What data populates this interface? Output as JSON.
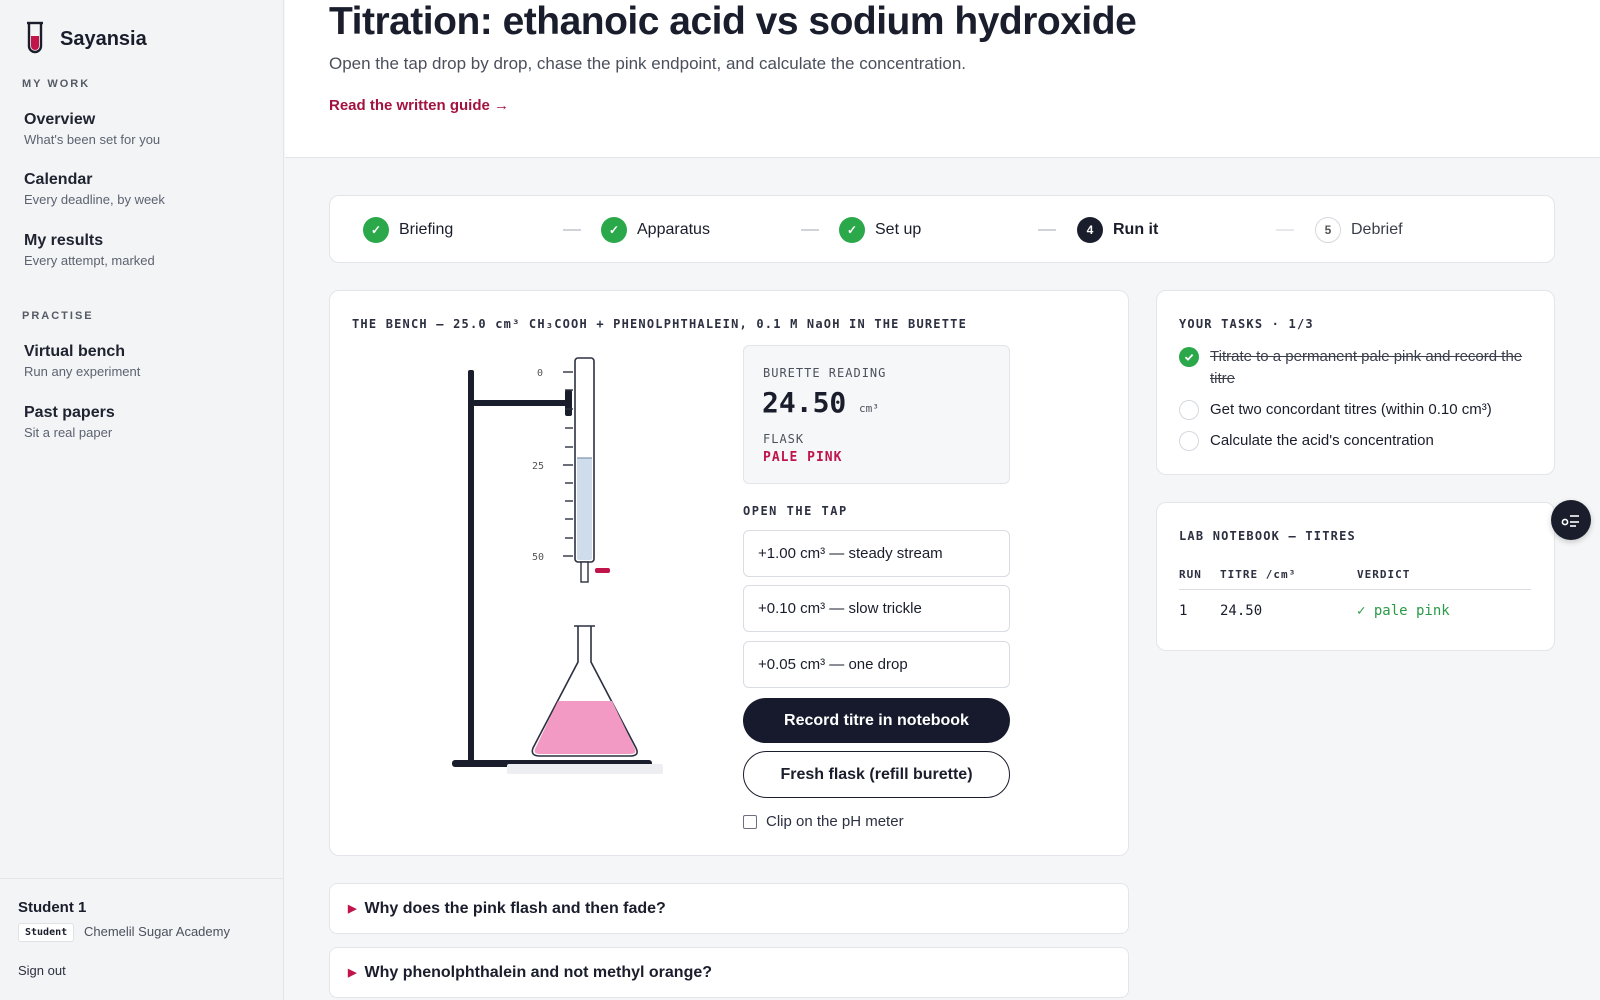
{
  "app": {
    "name": "Sayansia"
  },
  "sidebar": {
    "sections": [
      {
        "label": "MY WORK",
        "items": [
          {
            "title": "Overview",
            "subtitle": "What's been set for you"
          },
          {
            "title": "Calendar",
            "subtitle": "Every deadline, by week"
          },
          {
            "title": "My results",
            "subtitle": "Every attempt, marked"
          }
        ]
      },
      {
        "label": "PRACTISE",
        "items": [
          {
            "title": "Virtual bench",
            "subtitle": "Run any experiment"
          },
          {
            "title": "Past papers",
            "subtitle": "Sit a real paper"
          }
        ]
      }
    ],
    "user": {
      "name": "Student 1",
      "role": "Student",
      "school": "Chemelil Sugar Academy",
      "sign_out": "Sign out"
    }
  },
  "header": {
    "title": "Titration: ethanoic acid vs sodium hydroxide",
    "subtitle": "Open the tap drop by drop, chase the pink endpoint, and calculate the concentration.",
    "guide_link": "Read the written guide →"
  },
  "stepper": {
    "steps": [
      {
        "label": "Briefing",
        "state": "done",
        "marker": "✓"
      },
      {
        "label": "Apparatus",
        "state": "done",
        "marker": "✓"
      },
      {
        "label": "Set up",
        "state": "done",
        "marker": "✓"
      },
      {
        "label": "Run it",
        "state": "active",
        "marker": "4"
      },
      {
        "label": "Debrief",
        "state": "todo",
        "marker": "5"
      }
    ]
  },
  "bench": {
    "label": "THE BENCH — 25.0 cm³ CH₃COOH + PHENOLPHTHALEIN, 0.1 M NaOH IN THE BURETTE",
    "burette_scale": [
      "0",
      "25",
      "50"
    ],
    "reading_label": "BURETTE READING",
    "reading_value": "24.50",
    "reading_unit": "cm³",
    "flask_label": "FLASK",
    "flask_state": "PALE PINK",
    "burette_fill_fraction": 0.51,
    "flask_color": "#f29ac4",
    "tap_label": "OPEN THE TAP",
    "tap_buttons": [
      "+1.00 cm³ — steady stream",
      "+0.10 cm³ — slow trickle",
      "+0.05 cm³ — one drop"
    ],
    "record_button": "Record titre in notebook",
    "fresh_button": "Fresh flask (refill burette)",
    "ph_meter_label": "Clip on the pH meter",
    "ph_meter_checked": false
  },
  "tasks": {
    "label": "YOUR TASKS · 1/3",
    "items": [
      {
        "text": "Titrate to a permanent pale pink and record the titre",
        "done": true
      },
      {
        "text": "Get two concordant titres (within 0.10 cm³)",
        "done": false
      },
      {
        "text": "Calculate the acid's concentration",
        "done": false
      }
    ]
  },
  "notebook": {
    "label": "LAB NOTEBOOK — TITRES",
    "columns": [
      "RUN",
      "TITRE /cm³",
      "VERDICT"
    ],
    "rows": [
      {
        "run": "1",
        "titre": "24.50",
        "verdict": "✓ pale pink"
      }
    ]
  },
  "faq": [
    "Why does the pink flash and then fade?",
    "Why phenolphthalein and not methyl orange?"
  ],
  "colors": {
    "accent": "#a3133f",
    "success": "#2aa84a",
    "dark": "#161a2c",
    "pink": "#f29ac4"
  }
}
